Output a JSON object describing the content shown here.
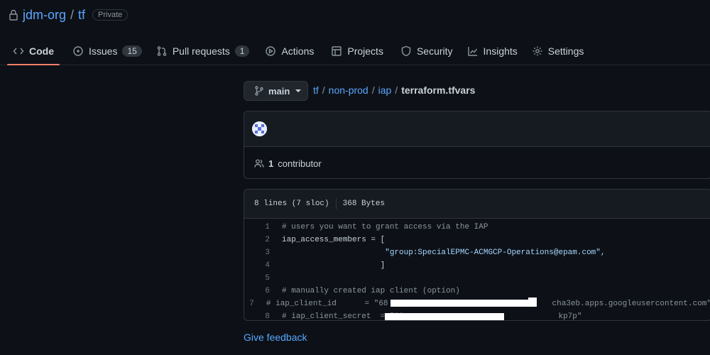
{
  "repo": {
    "owner": "jdm-org",
    "separator": "/",
    "name": "tf",
    "visibility": "Private",
    "lock_icon": "lock-icon"
  },
  "tabs": [
    {
      "label": "Code",
      "icon": "code-icon",
      "active": true
    },
    {
      "label": "Issues",
      "icon": "issue-icon",
      "count": "15"
    },
    {
      "label": "Pull requests",
      "icon": "pull-request-icon",
      "count": "1"
    },
    {
      "label": "Actions",
      "icon": "play-icon"
    },
    {
      "label": "Projects",
      "icon": "table-icon"
    },
    {
      "label": "Security",
      "icon": "shield-icon"
    },
    {
      "label": "Insights",
      "icon": "graph-icon"
    },
    {
      "label": "Settings",
      "icon": "gear-icon"
    }
  ],
  "branch": {
    "label": "main",
    "icon": "branch-icon"
  },
  "breadcrumb": {
    "parts": [
      "tf",
      "non-prod",
      "iap"
    ],
    "separator": "/",
    "file": "terraform.tfvars"
  },
  "commit": {
    "contributors_count": "1",
    "contributors_label": "contributor",
    "contributors_icon": "people-icon"
  },
  "file_info": {
    "lines": "8 lines (7 sloc)",
    "size": "368 Bytes"
  },
  "code_lines": [
    {
      "n": "1",
      "text": "# users you want to grant access via the IAP",
      "comment": true
    },
    {
      "n": "2",
      "text": "iap_access_members = ["
    },
    {
      "n": "3",
      "text": "                      \"group:SpecialEPMC-ACMGCP-Operations@epam.com\",",
      "string": true
    },
    {
      "n": "4",
      "text": "                     ]"
    },
    {
      "n": "5",
      "text": ""
    },
    {
      "n": "6",
      "text": "# manually created iap client (option)",
      "comment": true
    },
    {
      "n": "7",
      "text": "# iap_client_id      = \"68                                   cha3eb.apps.googleusercontent.com\"",
      "comment": true
    },
    {
      "n": "8",
      "text": "# iap_client_secret  = \"GO                                 kp7p\"",
      "comment": true
    }
  ],
  "feedback_label": "Give feedback",
  "colors": {
    "background": "#0d1117",
    "link": "#58a6ff",
    "active_tab_underline": "#f78166",
    "border": "#30363d"
  }
}
